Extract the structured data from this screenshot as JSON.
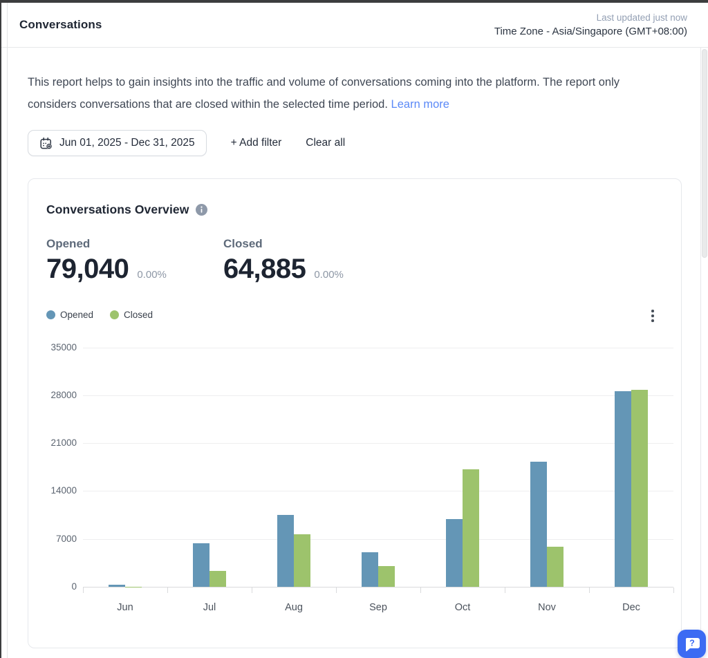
{
  "header": {
    "title": "Conversations",
    "last_updated": "Last updated just now",
    "timezone": "Time Zone - Asia/Singapore (GMT+08:00)"
  },
  "description": {
    "text": "This report helps to gain insights into the traffic and volume of conversations coming into the platform. The report only considers conversations that are closed within the selected time period.",
    "link": "Learn more"
  },
  "filters": {
    "date_range": "Jun 01, 2025 - Dec 31, 2025",
    "add_filter": "+ Add filter",
    "clear_all": "Clear all"
  },
  "card": {
    "title": "Conversations Overview",
    "stats": [
      {
        "label": "Opened",
        "value": "79,040",
        "change": "0.00%"
      },
      {
        "label": "Closed",
        "value": "64,885",
        "change": "0.00%"
      }
    ]
  },
  "icons": {
    "calendar": "calendar-plus-icon",
    "info": "info-icon",
    "kebab": "kebab-menu-icon",
    "help": "help-chat-bubble-icon"
  },
  "colors": {
    "opened_bar": "#6496b6",
    "closed_bar": "#9dc36c",
    "link_blue": "#5b89f7",
    "help_button": "#3c6bf3"
  },
  "chart_data": {
    "type": "bar",
    "title": "Conversations Overview",
    "categories": [
      "Jun",
      "Jul",
      "Aug",
      "Sep",
      "Oct",
      "Nov",
      "Dec"
    ],
    "series": [
      {
        "name": "Opened",
        "color": "#6496b6",
        "values": [
          260,
          6400,
          10500,
          5080,
          9900,
          18300,
          28600
        ]
      },
      {
        "name": "Closed",
        "color": "#9dc36c",
        "values": [
          35,
          2300,
          7700,
          3000,
          17200,
          5850,
          28800
        ]
      }
    ],
    "ylim": [
      0,
      35000
    ],
    "yticks": [
      0,
      7000,
      14000,
      21000,
      28000,
      35000
    ],
    "xlabel": "",
    "ylabel": "",
    "grid": true,
    "legend_position": "top-left",
    "legend": [
      "Opened",
      "Closed"
    ]
  }
}
